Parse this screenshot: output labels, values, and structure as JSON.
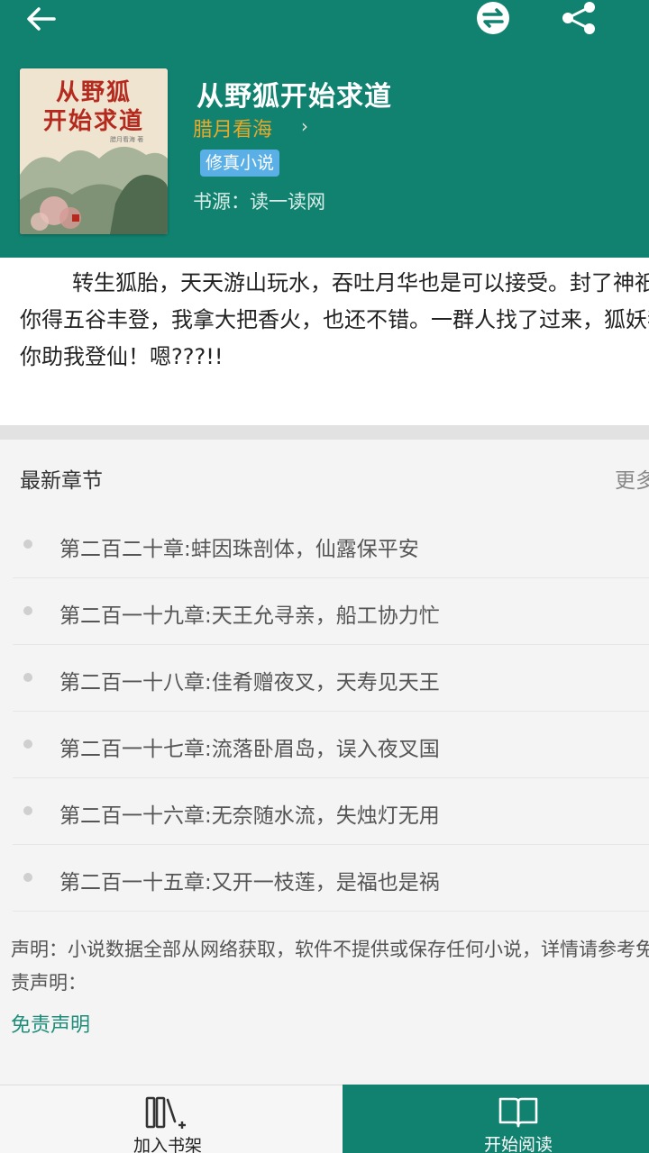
{
  "colors": {
    "accent": "#128270",
    "author": "#e9a928",
    "tag": "#5ab0e6",
    "link": "#1e8d7a"
  },
  "toolbar": {
    "back_icon": "arrow-left-icon",
    "swap_icon": "swap-source-icon",
    "share_icon": "share-icon"
  },
  "book": {
    "cover_line1": "从野狐",
    "cover_line2": "开始求道",
    "cover_author": "腊月看海 著",
    "title": "从野狐开始求道",
    "author": "腊月看海",
    "author_chevron": "›",
    "genre": "修真小说",
    "source": "书源：读一读网",
    "intro": "转生狐胎，天天游山玩水，吞吐月华也是可以接受。封了神祇，你得五谷丰登，我拿大把香火，也还不错。一群人找了过来，狐妖我要你助我登仙！嗯???!!"
  },
  "latest": {
    "label": "最新章节",
    "more": "更多",
    "chapters": [
      "第二百二十章:蚌因珠剖体，仙露保平安",
      "第二百一十九章:天王允寻亲，船工协力忙",
      "第二百一十八章:佳肴赠夜叉，天寿见天王",
      "第二百一十七章:流落卧眉岛，误入夜叉国",
      "第二百一十六章:无奈随水流，失烛灯无用",
      "第二百一十五章:又开一枝莲，是福也是祸"
    ]
  },
  "disclaimer": {
    "text": "声明：小说数据全部从网络获取，软件不提供或保存任何小说，详情请参考免责声明：",
    "link": "免责声明"
  },
  "bottom": {
    "bookshelf_label": "加入书架",
    "bookshelf_icon": "bookshelf-add-icon",
    "read_label": "开始阅读",
    "read_icon": "open-book-icon"
  }
}
